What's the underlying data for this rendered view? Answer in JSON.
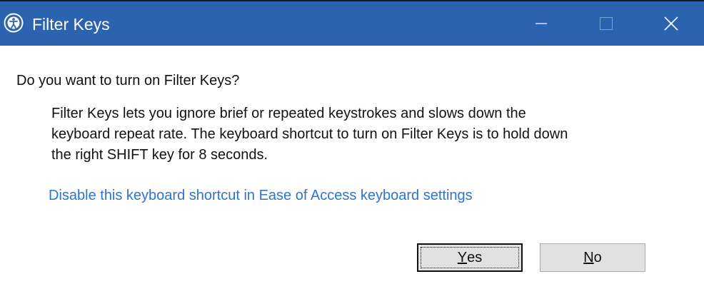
{
  "window": {
    "title": "Filter Keys",
    "title_color": "#2b63b0"
  },
  "caption_buttons": {
    "minimize_icon": "minimize-icon",
    "maximize_icon": "maximize-icon",
    "close_icon": "close-icon"
  },
  "content": {
    "question": "Do you want to turn on Filter Keys?",
    "description_lines": [
      "Filter Keys lets you ignore brief or repeated keystrokes and slows down the",
      "keyboard repeat rate.  The keyboard shortcut to turn on Filter Keys is to hold down",
      "the right SHIFT key for 8 seconds."
    ],
    "link_text": "Disable this keyboard shortcut in Ease of Access keyboard settings",
    "link_color": "#2d73d0"
  },
  "buttons": {
    "yes": {
      "mnemonic": "Y",
      "rest": "es"
    },
    "no": {
      "mnemonic": "N",
      "rest": "o"
    }
  }
}
